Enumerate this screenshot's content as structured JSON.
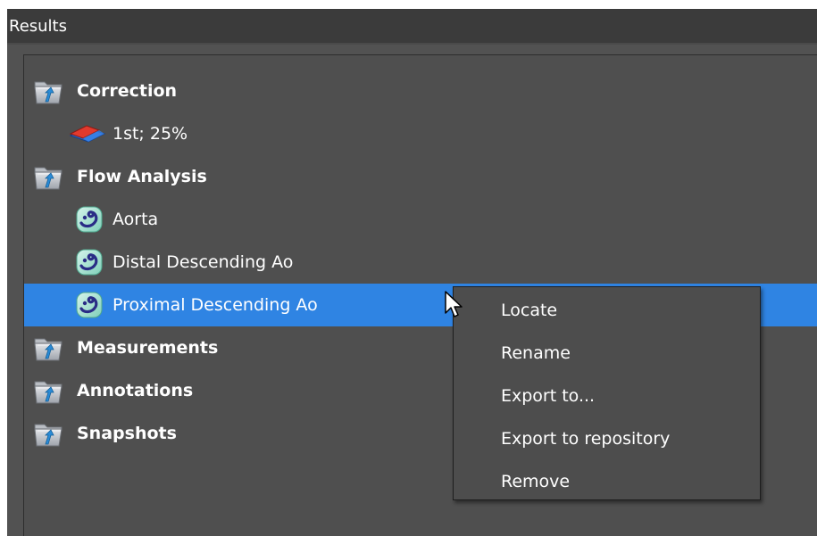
{
  "window": {
    "title": "Results"
  },
  "tree": {
    "correction": {
      "label": "Correction",
      "icon": "folder-icon",
      "children": [
        {
          "label": "1st; 25%",
          "icon": "correction-layers-icon"
        }
      ]
    },
    "flow_analysis": {
      "label": "Flow Analysis",
      "icon": "folder-icon",
      "children": [
        {
          "label": "Aorta",
          "icon": "flow-icon"
        },
        {
          "label": "Distal Descending Ao",
          "icon": "flow-icon"
        },
        {
          "label": "Proximal Descending Ao",
          "icon": "flow-icon",
          "selected": true
        }
      ]
    },
    "measurements": {
      "label": "Measurements",
      "icon": "folder-icon"
    },
    "annotations": {
      "label": "Annotations",
      "icon": "folder-icon"
    },
    "snapshots": {
      "label": "Snapshots",
      "icon": "folder-icon"
    }
  },
  "context_menu": {
    "items": [
      "Locate",
      "Rename",
      "Export to...",
      "Export to repository",
      "Remove"
    ]
  },
  "colors": {
    "selection": "#2f84e3",
    "panel_bg": "#4f4f4f",
    "menu_bg": "#4d4d4d",
    "title_bg": "#3b3b3b"
  }
}
